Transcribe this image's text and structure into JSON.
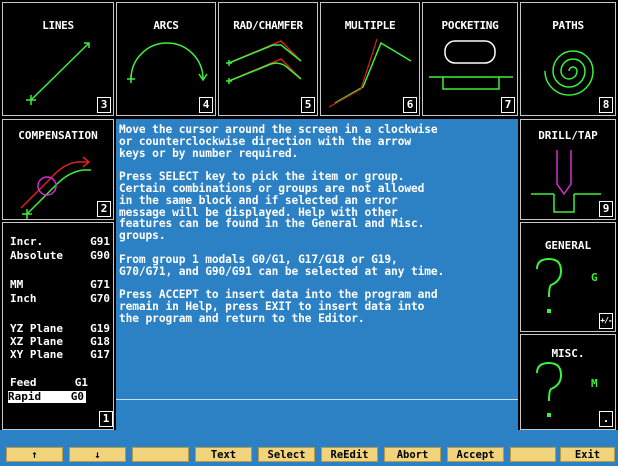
{
  "top_tiles": [
    {
      "title": "LINES",
      "num": "3"
    },
    {
      "title": "ARCS",
      "num": "4"
    },
    {
      "title": "RAD/CHAMFER",
      "num": "5"
    },
    {
      "title": "MULTIPLE",
      "num": "6"
    },
    {
      "title": "POCKETING",
      "num": "7"
    },
    {
      "title": "PATHS",
      "num": "8"
    }
  ],
  "compensation": {
    "title": "COMPENSATION",
    "num": "2"
  },
  "drill_tap": {
    "title": "DRILL/TAP",
    "num": "9"
  },
  "general": {
    "title": "GENERAL",
    "letter": "G",
    "key": "+/-"
  },
  "misc": {
    "title": "MISC.",
    "letter": "M",
    "key": "."
  },
  "help_text": "Move the cursor around the screen in a clockwise\nor counterclockwise direction with the arrow\nkeys or by number required.\n\nPress SELECT key to pick the item or group.\nCertain combinations or groups are not allowed\nin the same block and if selected an error\nmessage will be displayed. Help with other\nfeatures can be found in the General and Misc.\ngroups.\n\nFrom group 1 modals G0/G1, G17/G18 or G19,\nG70/G71, and G90/G91 can be selected at any time.\n\nPress ACCEPT to insert data into the program and\nremain in Help, press EXIT to insert data into\nthe program and return to the Editor.",
  "modals": [
    {
      "label": "Incr.",
      "code": "G91"
    },
    {
      "label": "Absolute",
      "code": "G90"
    },
    {
      "label": "MM",
      "code": "G71"
    },
    {
      "label": "Inch",
      "code": "G70"
    },
    {
      "label": "YZ Plane",
      "code": "G19"
    },
    {
      "label": "XZ Plane",
      "code": "G18"
    },
    {
      "label": "XY Plane",
      "code": "G17"
    },
    {
      "label": "Feed",
      "code": "G1"
    },
    {
      "label": "Rapid",
      "code": "G0"
    }
  ],
  "modal_num": "1",
  "fkeys": [
    "↑",
    "↓",
    "",
    "Text",
    "Select",
    "ReEdit",
    "Abort",
    "Accept",
    "",
    "Exit"
  ]
}
